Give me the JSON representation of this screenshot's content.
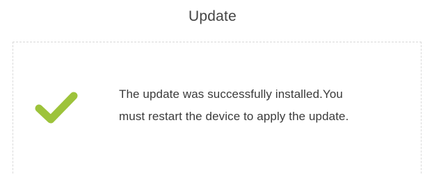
{
  "dialog": {
    "title": "Update",
    "message_lines": [
      "The update was successfully installed.You",
      "must restart the device to apply the update."
    ]
  },
  "icons": {
    "status": "checkmark-icon"
  },
  "colors": {
    "check": "#9dc33b",
    "title_text": "#444444",
    "message_text": "#3a3a3a",
    "panel_border": "#d9d9d9"
  }
}
